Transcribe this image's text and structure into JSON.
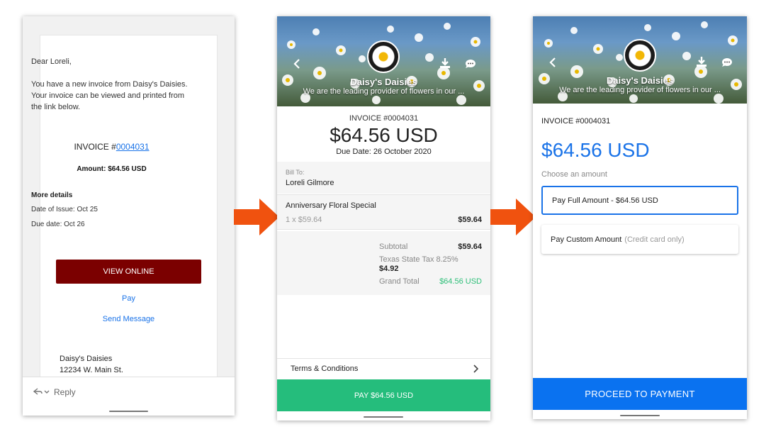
{
  "email": {
    "greeting": "Dear Loreli,",
    "body": "You have a new invoice from Daisy's Daisies. Your invoice can be viewed and printed from the link below.",
    "invoice_prefix": "INVOICE #",
    "invoice_number": "0004031",
    "amount": "Amount: $64.56 USD",
    "more_details": "More details",
    "date_of_issue": "Date of Issue: Oct 25",
    "due_date": "Due date: Oct 26",
    "view_online": "VIEW ONLINE",
    "pay_link": "Pay",
    "send_message_link": "Send Message",
    "business_name": "Daisy's Daisies",
    "business_address": "12234 W. Main St.",
    "reply_label": "Reply"
  },
  "business": {
    "name": "Daisy's Daisies",
    "tagline": "We are the leading provider of flowers in our ..."
  },
  "invoice": {
    "number": "INVOICE #0004031",
    "amount": "$64.56 USD",
    "due_date": "Due Date: 26 October 2020",
    "bill_to_label": "Bill To:",
    "bill_to_name": "Loreli Gilmore",
    "item_name": "Anniversary Floral Special",
    "item_qty": "1 x $59.64",
    "item_price": "$59.64",
    "subtotal_label": "Subtotal",
    "subtotal_value": "$59.64",
    "tax_label": "Texas State Tax 8.25%",
    "tax_value": "$4.92",
    "grand_total_label": "Grand Total",
    "grand_total_value": "$64.56 USD",
    "terms_label": "Terms & Conditions",
    "pay_button": "PAY $64.56 USD"
  },
  "payment": {
    "invoice_number": "INVOICE #0004031",
    "amount": "$64.56 USD",
    "choose_label": "Choose an amount",
    "full_amount_option": "Pay Full Amount - $64.56 USD",
    "custom_amount_option": "Pay Custom Amount",
    "custom_amount_note": "(Credit card only)",
    "proceed_button": "PROCEED TO PAYMENT"
  },
  "colors": {
    "view_online_button": "#7b0000",
    "pay_button": "#25bd7c",
    "proceed_button": "#0a72f0",
    "arrow": "#f0520f",
    "link": "#1a73e8"
  }
}
